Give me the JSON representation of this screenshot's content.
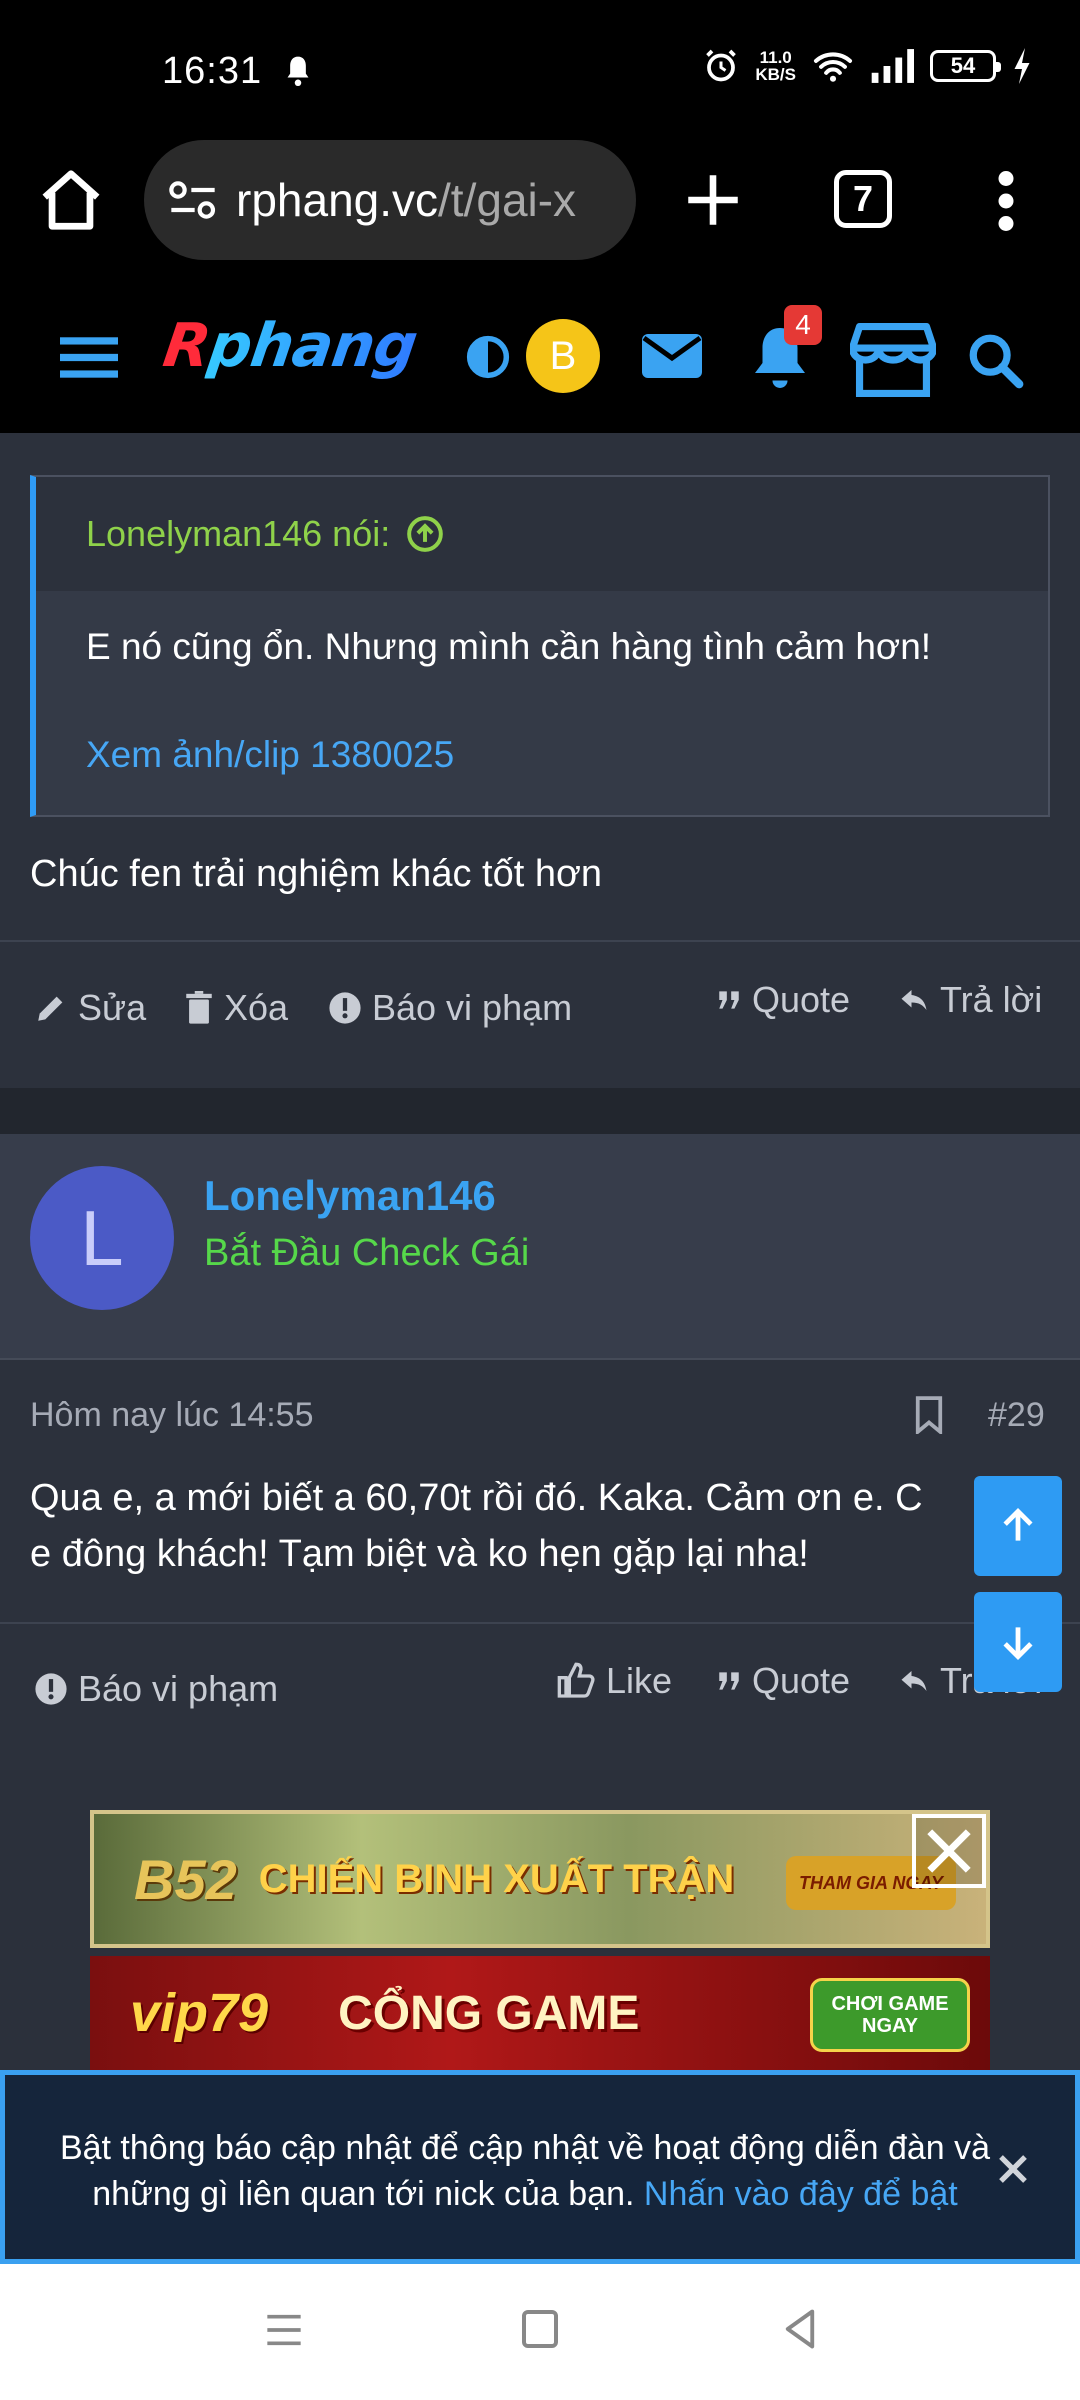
{
  "status_bar": {
    "time": "16:31",
    "net_speed_value": "11.0",
    "net_speed_unit": "KB/S",
    "battery": "54",
    "icons": [
      "bell-icon",
      "alarm-icon",
      "wifi-icon",
      "signal-icon",
      "battery-icon",
      "charging-icon"
    ]
  },
  "browser": {
    "url_host": "rphang.vc",
    "url_path": "/t/gai-x",
    "tab_count": "7"
  },
  "site_header": {
    "logo_first": "R",
    "logo_rest": "phang",
    "user_initial": "B",
    "notification_count": "4",
    "colors": {
      "accent": "#2f9bf5",
      "badge": "#e53935",
      "avatar": "#f5c518"
    }
  },
  "post_a": {
    "quote_author": "Lonelyman146 nói:",
    "quote_text": "E nó cũng ổn. Nhưng mình cần hàng tình cảm hơn!",
    "quote_link": "Xem ảnh/clip 1380025",
    "text": "Chúc fen trải nghiệm khác tốt hơn",
    "actions": {
      "edit": "Sửa",
      "delete": "Xóa",
      "report": "Báo vi phạm",
      "quote": "Quote",
      "reply": "Trả lời"
    }
  },
  "post_b": {
    "user_initial": "L",
    "username": "Lonelyman146",
    "user_title": "Bắt Đầu Check Gái",
    "timestamp": "Hôm nay lúc 14:55",
    "post_number": "#29",
    "text_line1": "Qua e, a mới biết a 60,70t rồi đó. Kaka. Cảm ơn e. C",
    "text_line2": "e đông khách! Tạm biệt và ko hẹn gặp lại nha!",
    "actions": {
      "report": "Báo vi phạm",
      "like": "Like",
      "quote": "Quote",
      "reply": "Trả lời"
    }
  },
  "ads": {
    "ad1_logo": "B52",
    "ad1_text": "CHIẾN BINH XUẤT TRẬN",
    "ad1_button": "THAM GIA NGAY",
    "ad2_logo": "vip79",
    "ad2_text": "CỔNG GAME",
    "ad2_button": "CHƠI GAME NGAY"
  },
  "notification_banner": {
    "text": "Bật thông báo cập nhật để cập nhật về hoạt động diễn đàn và những gì liên quan tới nick của bạn.",
    "link": "Nhấn vào đây để bật"
  }
}
